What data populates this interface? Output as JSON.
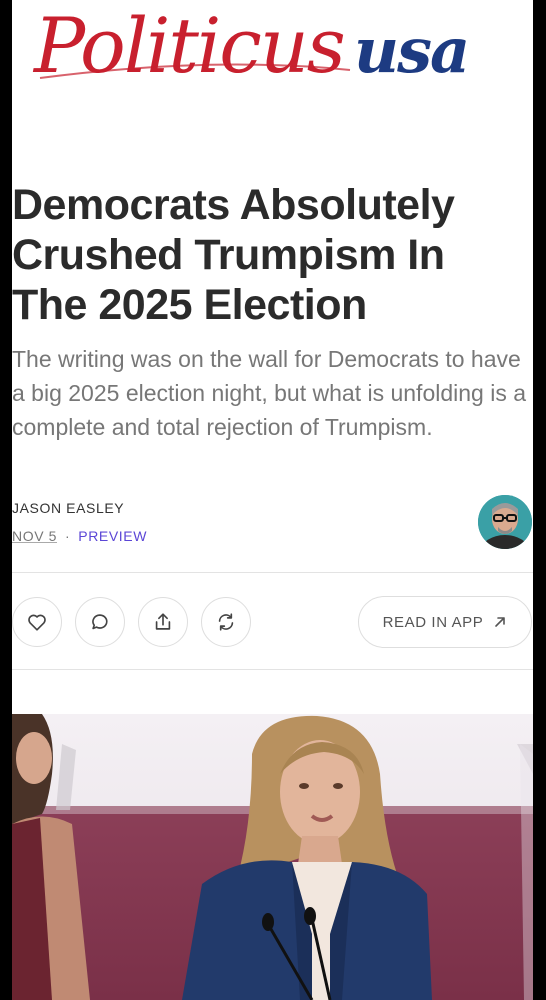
{
  "logo": {
    "text": "Politicususa",
    "colors": {
      "politicus": "#c8202e",
      "usa": "#1d3b82"
    }
  },
  "article": {
    "headline": "Democrats Absolutely Crushed Trumpism In The 2025 Election",
    "subtitle": "The writing was on the wall for Democrats to have a big 2025 election night, but what is unfolding is a complete and total rejection of Trumpism.",
    "author": "JASON EASLEY",
    "date": "NOV 5",
    "separator": "·",
    "access_label": "PREVIEW"
  },
  "actions": {
    "like_icon": "heart-icon",
    "comment_icon": "comment-icon",
    "share_icon": "share-icon",
    "restack_icon": "restack-icon",
    "read_in_app_label": "READ IN APP",
    "read_in_app_icon": "arrow-up-right-icon"
  },
  "colors": {
    "accent": "#5b46d6",
    "headline": "#2b2b2b",
    "subtitle": "#777777",
    "border": "#dedede"
  }
}
